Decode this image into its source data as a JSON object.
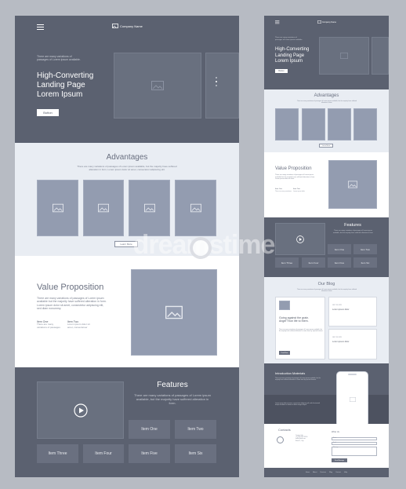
{
  "colors": {
    "dark": "#5b6170",
    "light": "#e9edf3",
    "placeholder": "#939cb0",
    "page_bg": "#b7bbc3"
  },
  "desktop": {
    "brand": "Company Name",
    "hero": {
      "intro": "There are many variations of passages of Lorem ipsum available.",
      "title_lines": [
        "High-Converting",
        "Landing Page",
        "Lorem Ipsum"
      ],
      "button": "Button"
    },
    "advantages": {
      "title": "Advantages",
      "text": "There are many variations of passages of Lorem ipsum available, but the majority have suffered alteration in form, Lorem ipsum dolor sit amet, consectetur adipiscing elit.",
      "button": "Learn More"
    },
    "value": {
      "title": "Value Proposition",
      "text": "There are many variations of passages of Lorem ipsum available but the majority have suffered alteration in form. Lorem ipsum dolor sit amet, consectetur adipiscing elit, sed diam nonummy.",
      "item_one_title": "Item One",
      "item_one_text": "There are many variations of passages",
      "item_two_title": "Item Two",
      "item_two_text": "Lorem ipsum dolor sit amet, consectetuer"
    },
    "features": {
      "title": "Features",
      "text": "There are many variations of passages of Lorem ipsum available, but the majority have suffered alteration in form.",
      "items": [
        "Item One",
        "Item Two",
        "Item Three",
        "Item Four",
        "Item Five",
        "Item Six"
      ]
    }
  },
  "mobile": {
    "brand": "Company Name",
    "hero": {
      "intro": "There are many variations of passages of Lorem ipsum available.",
      "title_lines": [
        "High-Converting",
        "Landing Page",
        "Lorem Ipsum"
      ],
      "button": "Button"
    },
    "advantages": {
      "title": "Advantages",
      "text": "There are many variations of passages of Lorem ipsum available, but the majority have suffered alteration in form.",
      "button": "Learn More"
    },
    "value": {
      "title": "Value Proposition",
      "text": "There are many variations of passages of Lorem ipsum available but the majority have suffered alteration in form. Lorem ipsum dolor sit amet.",
      "item_one_title": "Item One",
      "item_one_text": "There are many variations",
      "item_two_title": "Item Two",
      "item_two_text": "Lorem ipsum dolor"
    },
    "features": {
      "title": "Features",
      "text": "There are many variations of passages of Lorem ipsum available, but the majority have suffered alteration in form.",
      "items": [
        "Item One",
        "Item Two",
        "Item Three",
        "Item Four",
        "Item Five",
        "Item Six"
      ]
    },
    "blog": {
      "title": "Our Blog",
      "text": "There are many variations of passages of Lorem ipsum available, but the majority have suffered alteration in form.",
      "post1_title": "Going against the grain. Angel'Thon life to them.",
      "post1_text": "There are many variations of passages of Lorem ipsum available, but the majority have suffered alteration in some form, by injected humour.",
      "post1_button": "Read More",
      "post2_date": "JULY 18, 2019",
      "post2_title": "Lorem ipsum dolor",
      "post3_date": "JULY 18, 2019",
      "post3_title": "Lorem ipsum dolor"
    },
    "intro": {
      "title": "Introduction Materials",
      "text": "There are many variations of passages of Lorem ipsum available, but the majority have suffered alteration in some form by injected humour.",
      "text2": "Lorem ipsum dolor sit amet, consectetur adipiscing elit, sed do eiusmod tempor incididunt ut labore et dolore magna aliqua."
    },
    "contacts": {
      "title": "Contacts",
      "lines": [
        "Contact Info",
        "+1 (123) 456 78 90",
        "hello@mail.com",
        "Street 1, City"
      ],
      "form_title": "Write Us",
      "field_name": "Name",
      "field_email": "Email",
      "field_message": "Message",
      "submit": "Send Message"
    },
    "footer": [
      "Home",
      "About",
      "Services",
      "Blog",
      "Contact",
      "Help"
    ]
  },
  "watermark": "dreamstime"
}
